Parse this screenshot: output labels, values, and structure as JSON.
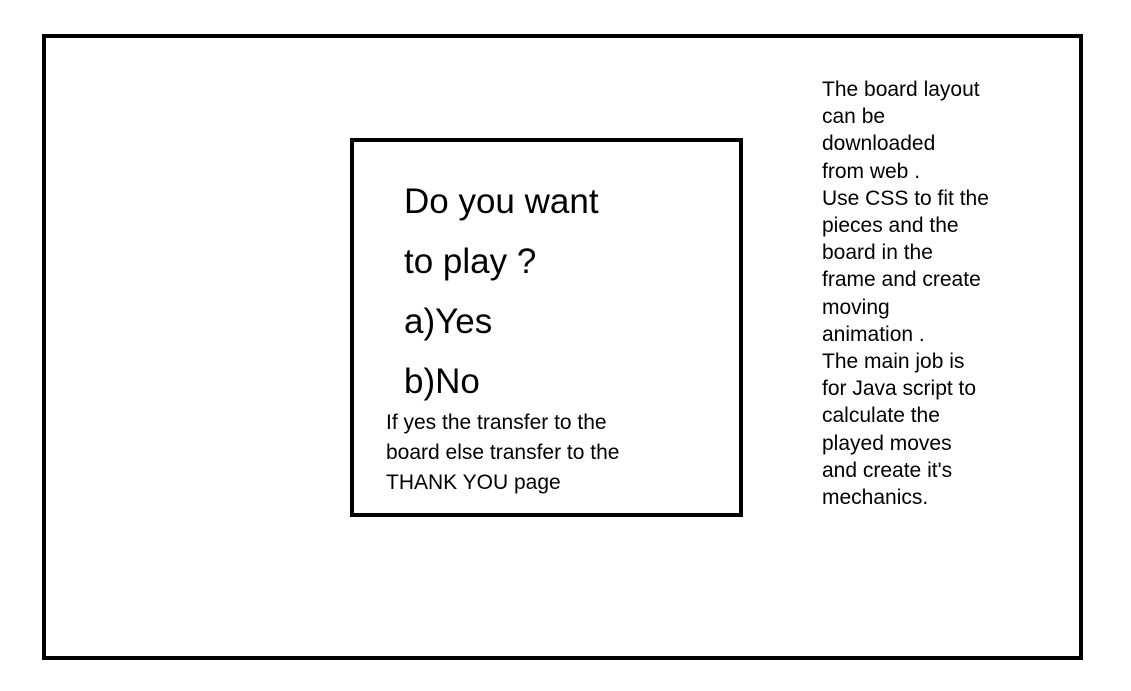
{
  "dialog": {
    "question_lines": [
      "Do you want",
      "to play ?",
      "a)Yes",
      "b)No"
    ],
    "instruction_lines": [
      "If yes the transfer to the",
      "board else transfer to the",
      "THANK YOU page"
    ]
  },
  "note": {
    "lines": [
      "The board layout",
      "can be",
      "downloaded",
      "from web .",
      "Use CSS to fit the",
      "pieces and the",
      "board in the",
      "frame and create",
      "moving",
      "animation .",
      "The main job is",
      "for Java script to",
      "calculate the",
      "played moves",
      "and create it's",
      "mechanics."
    ]
  }
}
